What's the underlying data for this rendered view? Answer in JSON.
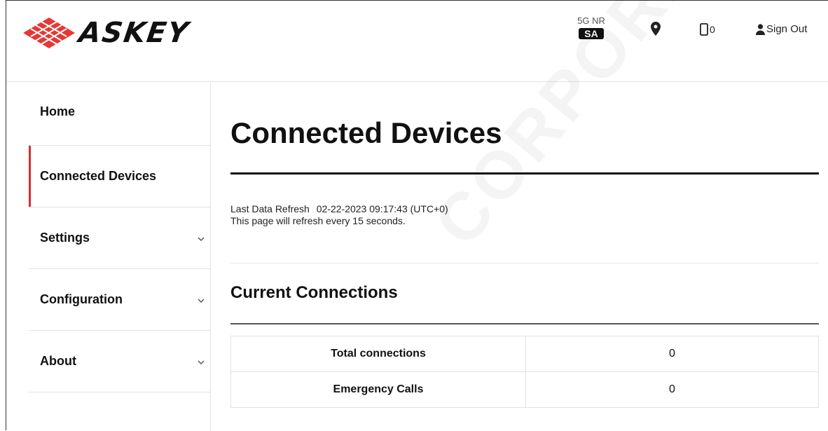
{
  "header": {
    "logo_text": "ASKEY",
    "network": {
      "type": "5G NR",
      "mode": "SA"
    },
    "devices_count": "0",
    "sign_out_label": "Sign Out"
  },
  "sidebar": {
    "items": [
      {
        "label": "Home",
        "active": false,
        "expandable": false
      },
      {
        "label": "Connected Devices",
        "active": true,
        "expandable": false
      },
      {
        "label": "Settings",
        "active": false,
        "expandable": true
      },
      {
        "label": "Configuration",
        "active": false,
        "expandable": true
      },
      {
        "label": "About",
        "active": false,
        "expandable": true
      }
    ]
  },
  "main": {
    "title": "Connected Devices",
    "refresh_label": "Last Data Refresh",
    "refresh_time": "02-22-2023 09:17:43 (UTC+0)",
    "refresh_note": "This page will refresh every 15 seconds.",
    "section_title": "Current Connections",
    "rows": [
      {
        "label": "Total connections",
        "value": "0"
      },
      {
        "label": "Emergency Calls",
        "value": "0"
      }
    ]
  },
  "watermark": "CORPORATION",
  "colors": {
    "accent": "#d32f2f",
    "logo_red": "#e53935"
  },
  "icons": [
    "askey-logo-icon",
    "location-pin-icon",
    "device-icon",
    "user-icon",
    "chevron-down-icon"
  ]
}
